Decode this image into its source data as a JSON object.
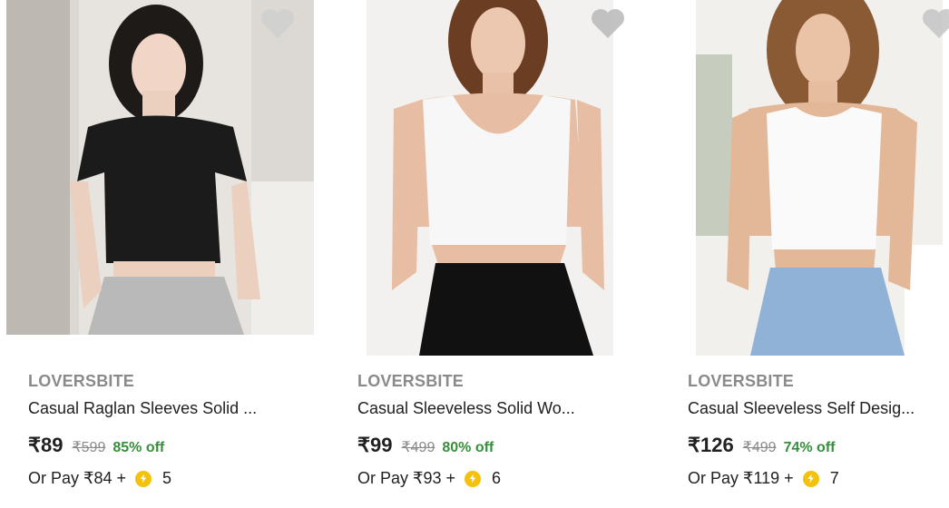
{
  "products": [
    {
      "brand": "LOVERSBITE",
      "title": "Casual Raglan Sleeves Solid ...",
      "price": "₹89",
      "mrp": "₹599",
      "discount": "85% off",
      "pay_text": "Or Pay ₹84 +",
      "coins": "5",
      "top_color": "#1b1b1b",
      "bottom_color": "#b9b9b9",
      "bg_color": "#dcd9d4",
      "wishlist_icon": "heart-icon"
    },
    {
      "brand": "LOVERSBITE",
      "title": "Casual Sleeveless Solid Wo...",
      "price": "₹99",
      "mrp": "₹499",
      "discount": "80% off",
      "pay_text": "Or Pay ₹93 +",
      "coins": "6",
      "top_color": "#f7f7f7",
      "bottom_color": "#111111",
      "bg_color": "#f3f1ef",
      "wishlist_icon": "heart-icon"
    },
    {
      "brand": "LOVERSBITE",
      "title": "Casual Sleeveless Self Desig...",
      "price": "₹126",
      "mrp": "₹499",
      "discount": "74% off",
      "pay_text": "Or Pay ₹119 +",
      "coins": "7",
      "top_color": "#fafafa",
      "bottom_color": "#8fb2d6",
      "bg_color": "#f2f0ed",
      "wishlist_icon": "heart-icon"
    }
  ],
  "colors": {
    "discount": "#388e3c",
    "coin": "#f4c20d",
    "brand": "#8a8a8a"
  }
}
